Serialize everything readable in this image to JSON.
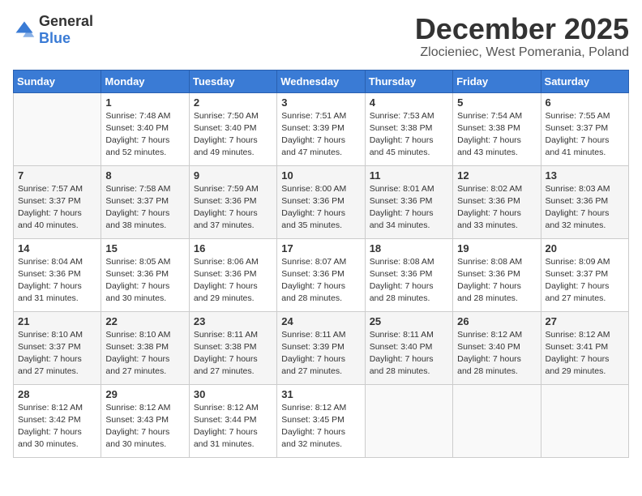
{
  "header": {
    "logo_general": "General",
    "logo_blue": "Blue",
    "title": "December 2025",
    "subtitle": "Zlocieniec, West Pomerania, Poland"
  },
  "calendar": {
    "days_of_week": [
      "Sunday",
      "Monday",
      "Tuesday",
      "Wednesday",
      "Thursday",
      "Friday",
      "Saturday"
    ],
    "weeks": [
      [
        {
          "day": "",
          "content": ""
        },
        {
          "day": "1",
          "content": "Sunrise: 7:48 AM\nSunset: 3:40 PM\nDaylight: 7 hours\nand 52 minutes."
        },
        {
          "day": "2",
          "content": "Sunrise: 7:50 AM\nSunset: 3:40 PM\nDaylight: 7 hours\nand 49 minutes."
        },
        {
          "day": "3",
          "content": "Sunrise: 7:51 AM\nSunset: 3:39 PM\nDaylight: 7 hours\nand 47 minutes."
        },
        {
          "day": "4",
          "content": "Sunrise: 7:53 AM\nSunset: 3:38 PM\nDaylight: 7 hours\nand 45 minutes."
        },
        {
          "day": "5",
          "content": "Sunrise: 7:54 AM\nSunset: 3:38 PM\nDaylight: 7 hours\nand 43 minutes."
        },
        {
          "day": "6",
          "content": "Sunrise: 7:55 AM\nSunset: 3:37 PM\nDaylight: 7 hours\nand 41 minutes."
        }
      ],
      [
        {
          "day": "7",
          "content": "Sunrise: 7:57 AM\nSunset: 3:37 PM\nDaylight: 7 hours\nand 40 minutes."
        },
        {
          "day": "8",
          "content": "Sunrise: 7:58 AM\nSunset: 3:37 PM\nDaylight: 7 hours\nand 38 minutes."
        },
        {
          "day": "9",
          "content": "Sunrise: 7:59 AM\nSunset: 3:36 PM\nDaylight: 7 hours\nand 37 minutes."
        },
        {
          "day": "10",
          "content": "Sunrise: 8:00 AM\nSunset: 3:36 PM\nDaylight: 7 hours\nand 35 minutes."
        },
        {
          "day": "11",
          "content": "Sunrise: 8:01 AM\nSunset: 3:36 PM\nDaylight: 7 hours\nand 34 minutes."
        },
        {
          "day": "12",
          "content": "Sunrise: 8:02 AM\nSunset: 3:36 PM\nDaylight: 7 hours\nand 33 minutes."
        },
        {
          "day": "13",
          "content": "Sunrise: 8:03 AM\nSunset: 3:36 PM\nDaylight: 7 hours\nand 32 minutes."
        }
      ],
      [
        {
          "day": "14",
          "content": "Sunrise: 8:04 AM\nSunset: 3:36 PM\nDaylight: 7 hours\nand 31 minutes."
        },
        {
          "day": "15",
          "content": "Sunrise: 8:05 AM\nSunset: 3:36 PM\nDaylight: 7 hours\nand 30 minutes."
        },
        {
          "day": "16",
          "content": "Sunrise: 8:06 AM\nSunset: 3:36 PM\nDaylight: 7 hours\nand 29 minutes."
        },
        {
          "day": "17",
          "content": "Sunrise: 8:07 AM\nSunset: 3:36 PM\nDaylight: 7 hours\nand 28 minutes."
        },
        {
          "day": "18",
          "content": "Sunrise: 8:08 AM\nSunset: 3:36 PM\nDaylight: 7 hours\nand 28 minutes."
        },
        {
          "day": "19",
          "content": "Sunrise: 8:08 AM\nSunset: 3:36 PM\nDaylight: 7 hours\nand 28 minutes."
        },
        {
          "day": "20",
          "content": "Sunrise: 8:09 AM\nSunset: 3:37 PM\nDaylight: 7 hours\nand 27 minutes."
        }
      ],
      [
        {
          "day": "21",
          "content": "Sunrise: 8:10 AM\nSunset: 3:37 PM\nDaylight: 7 hours\nand 27 minutes."
        },
        {
          "day": "22",
          "content": "Sunrise: 8:10 AM\nSunset: 3:38 PM\nDaylight: 7 hours\nand 27 minutes."
        },
        {
          "day": "23",
          "content": "Sunrise: 8:11 AM\nSunset: 3:38 PM\nDaylight: 7 hours\nand 27 minutes."
        },
        {
          "day": "24",
          "content": "Sunrise: 8:11 AM\nSunset: 3:39 PM\nDaylight: 7 hours\nand 27 minutes."
        },
        {
          "day": "25",
          "content": "Sunrise: 8:11 AM\nSunset: 3:40 PM\nDaylight: 7 hours\nand 28 minutes."
        },
        {
          "day": "26",
          "content": "Sunrise: 8:12 AM\nSunset: 3:40 PM\nDaylight: 7 hours\nand 28 minutes."
        },
        {
          "day": "27",
          "content": "Sunrise: 8:12 AM\nSunset: 3:41 PM\nDaylight: 7 hours\nand 29 minutes."
        }
      ],
      [
        {
          "day": "28",
          "content": "Sunrise: 8:12 AM\nSunset: 3:42 PM\nDaylight: 7 hours\nand 30 minutes."
        },
        {
          "day": "29",
          "content": "Sunrise: 8:12 AM\nSunset: 3:43 PM\nDaylight: 7 hours\nand 30 minutes."
        },
        {
          "day": "30",
          "content": "Sunrise: 8:12 AM\nSunset: 3:44 PM\nDaylight: 7 hours\nand 31 minutes."
        },
        {
          "day": "31",
          "content": "Sunrise: 8:12 AM\nSunset: 3:45 PM\nDaylight: 7 hours\nand 32 minutes."
        },
        {
          "day": "",
          "content": ""
        },
        {
          "day": "",
          "content": ""
        },
        {
          "day": "",
          "content": ""
        }
      ]
    ]
  }
}
